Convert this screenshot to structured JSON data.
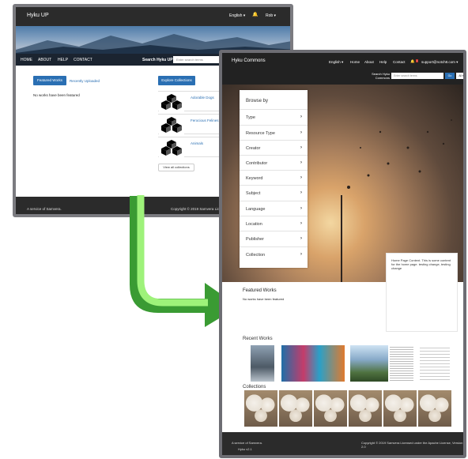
{
  "before": {
    "brand": "Hyku UP",
    "lang": "English ▾",
    "user": "Rob ▾",
    "menu": [
      "HOME",
      "ABOUT",
      "HELP",
      "CONTACT"
    ],
    "search_label": "Search Hyku UP",
    "search_placeholder": "Enter search terms",
    "tab_featured": "Featured Works",
    "tab_recent": "Recently Uploaded",
    "no_featured": "No works have been featured",
    "explore": "Explore Collections",
    "collections": [
      "Adorable Dogs",
      "Ferocious Felines",
      "Animals"
    ],
    "view_all": "View all collections",
    "footer_left": "A service of Samvera.",
    "footer_right": "Copyright © 2019 Samvera Licens..."
  },
  "after": {
    "brand": "Hyku Commons",
    "nav": [
      "English ▾",
      "Home",
      "About",
      "Help",
      "Contact"
    ],
    "email": "support@notch8.com ▾",
    "search_label": "Search Hyku Commons",
    "search_placeholder": "Enter search terms",
    "go": "Go",
    "all": "All ▾",
    "browse_title": "Browse by",
    "facets": [
      "Type",
      "Resource Type",
      "Creator",
      "Contributor",
      "Keyword",
      "Subject",
      "Language",
      "Location",
      "Publisher",
      "Collection"
    ],
    "marketing_text": "Home Page Content. This is some content for the home page. testing change, testing change",
    "featured_title": "Featured Works",
    "featured_text": "No works have been featured",
    "recent_title": "Recent Works",
    "collections_title": "Collections",
    "footer_left": "A service of Samvera.",
    "footer_version": "Hyku v2.1",
    "footer_right": "Copyright © 2019 Samvera Licensed under the Apache License, Version 2.0"
  },
  "colors": {
    "nav": "#2b2b2b",
    "link": "#2a6fb3",
    "arrow_dark": "#3a9b33",
    "arrow_light": "#9ef27a"
  }
}
